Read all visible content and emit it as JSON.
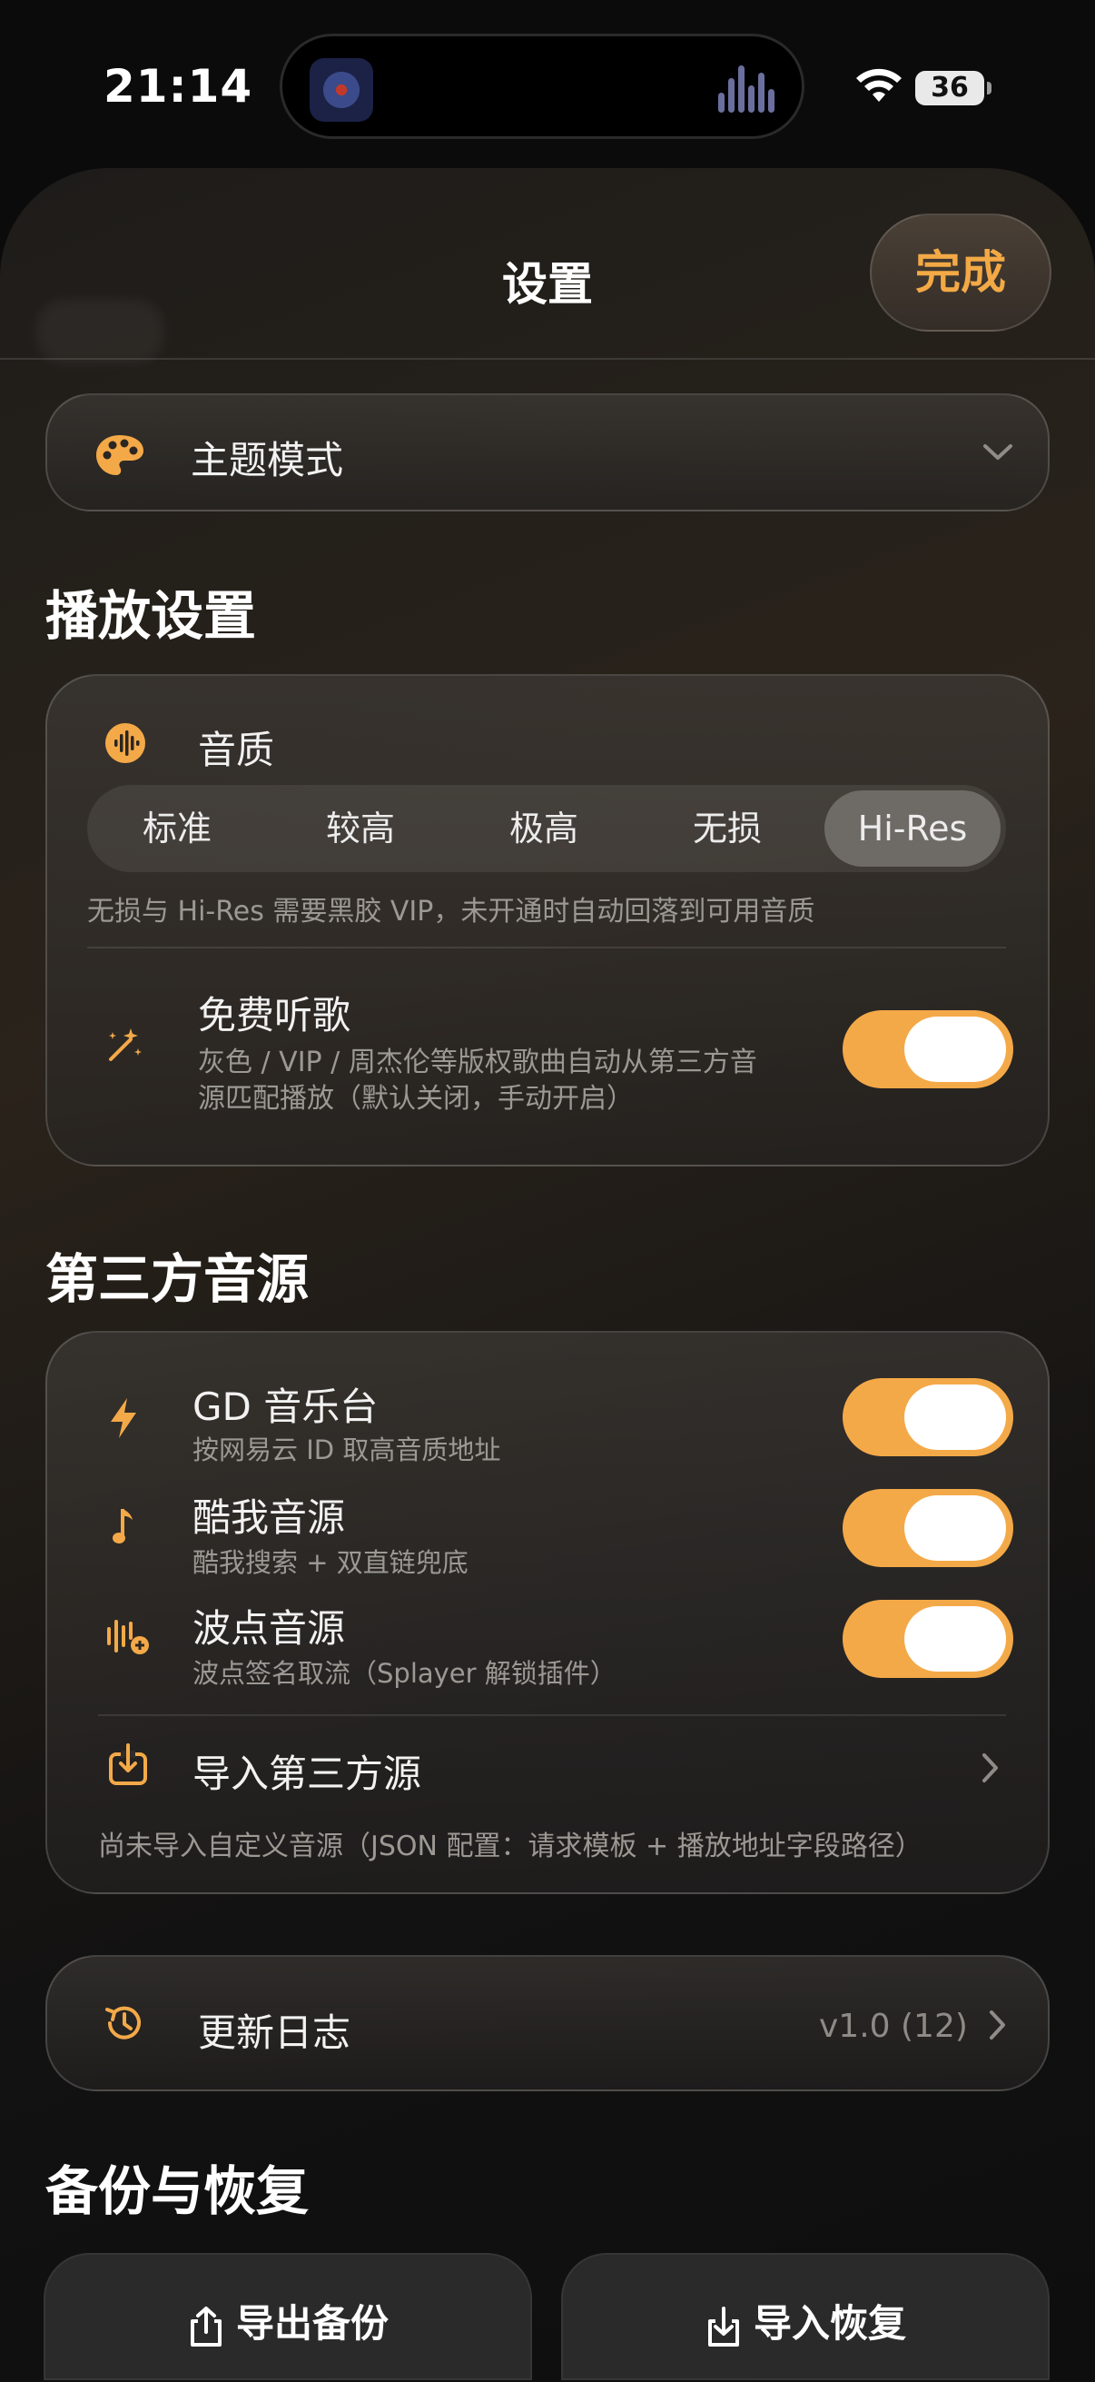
{
  "status_bar": {
    "time": "21:14",
    "battery": "36"
  },
  "sheet": {
    "title": "设置",
    "done_label": "完成"
  },
  "theme": {
    "label": "主题模式"
  },
  "playback": {
    "heading": "播放设置",
    "quality": {
      "label": "音质",
      "options": [
        "标准",
        "较高",
        "极高",
        "无损",
        "Hi-Res"
      ],
      "selected": "Hi-Res",
      "note": "无损与 Hi-Res 需要黑胶 VIP，未开通时自动回落到可用音质"
    },
    "free_listen": {
      "label": "免费听歌",
      "desc_line1": "灰色 / VIP / 周杰伦等版权歌曲自动从第三方音",
      "desc_line2": "源匹配播放（默认关闭，手动开启）",
      "enabled": true
    }
  },
  "third_party": {
    "heading": "第三方音源",
    "sources": [
      {
        "name": "GD 音乐台",
        "desc": "按网易云 ID 取高音质地址",
        "icon": "bolt-icon",
        "enabled": true
      },
      {
        "name": "酷我音源",
        "desc": "酷我搜索 + 双直链兜底",
        "icon": "music-note-icon",
        "enabled": true
      },
      {
        "name": "波点音源",
        "desc": "波点签名取流（Splayer 解锁插件）",
        "icon": "waveform-plus-icon",
        "enabled": true
      }
    ],
    "import_label": "导入第三方源",
    "import_note": "尚未导入自定义音源（JSON 配置：请求模板 + 播放地址字段路径）"
  },
  "changelog": {
    "label": "更新日志",
    "version": "v1.0 (12)"
  },
  "backup": {
    "heading": "备份与恢复",
    "export_label": "导出备份",
    "import_label": "导入恢复"
  },
  "colors": {
    "accent": "#f4a948",
    "background": "#0b0b0c"
  }
}
